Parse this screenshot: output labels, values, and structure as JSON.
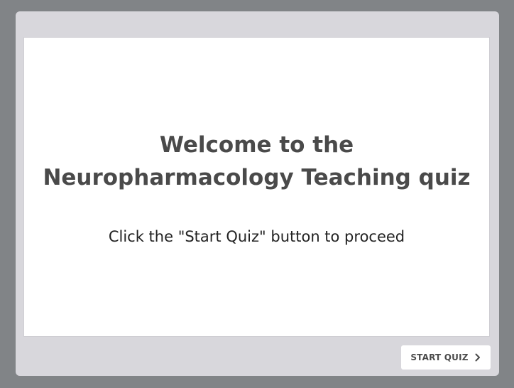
{
  "slide": {
    "title_line1": "Welcome to the",
    "title_line2": "Neuropharmacology Teaching quiz",
    "subtitle": "Click the \"Start Quiz\" button to proceed"
  },
  "footer": {
    "start_button_label": "START QUIZ",
    "start_button_icon": "chevron-right-icon"
  },
  "colors": {
    "page_background": "#818487",
    "frame_background": "#d8d7dc",
    "slide_background": "#ffffff",
    "title_text": "#4a4a4a"
  }
}
